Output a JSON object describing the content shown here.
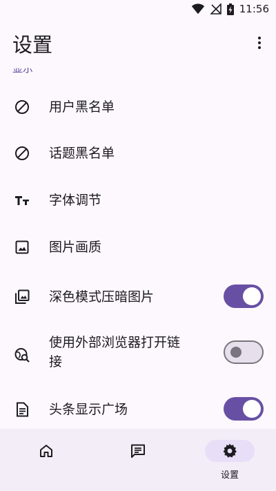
{
  "status_bar": {
    "time": "11:56"
  },
  "app_bar": {
    "title": "设置"
  },
  "section": {
    "header": "显示"
  },
  "settings": [
    {
      "label": "用户黑名单",
      "icon": "block-icon"
    },
    {
      "label": "话题黑名单",
      "icon": "block-icon"
    },
    {
      "label": "字体调节",
      "icon": "text-size-icon"
    },
    {
      "label": "图片画质",
      "icon": "image-icon"
    },
    {
      "label": "深色模式压暗图片",
      "icon": "photo-library-icon",
      "toggle": true
    },
    {
      "label_line1": "使用外部浏览器打开链",
      "label_line2": "接",
      "icon": "travel-explore-icon",
      "toggle": false
    },
    {
      "label": "头条显示广场",
      "icon": "article-icon",
      "toggle": true
    }
  ],
  "colors": {
    "accent": "#6750a4",
    "background": "#fdf8fd",
    "nav_background": "#f3edf7",
    "pill": "#e8def8"
  },
  "bottom_nav": {
    "items": [
      {
        "icon": "home-icon",
        "label": ""
      },
      {
        "icon": "message-icon",
        "label": ""
      },
      {
        "icon": "settings-icon",
        "label": "设置",
        "active": true
      }
    ]
  }
}
